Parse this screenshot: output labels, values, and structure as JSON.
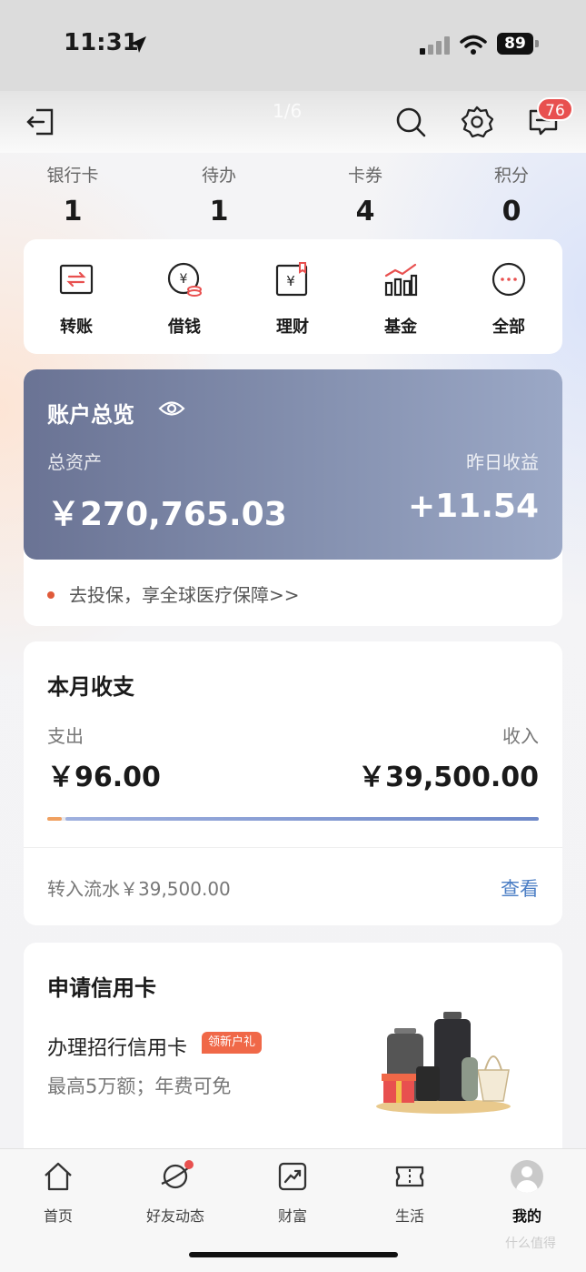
{
  "status_bar": {
    "time": "11:31",
    "battery": "89"
  },
  "topbar": {
    "page_indicator": "1/6",
    "message_badge": "76"
  },
  "stats": [
    {
      "label": "银行卡",
      "value": "1"
    },
    {
      "label": "待办",
      "value": "1"
    },
    {
      "label": "卡券",
      "value": "4"
    },
    {
      "label": "积分",
      "value": "0"
    }
  ],
  "quick_actions": [
    {
      "label": "转账",
      "icon": "transfer-icon"
    },
    {
      "label": "借钱",
      "icon": "borrow-icon"
    },
    {
      "label": "理财",
      "icon": "wealth-icon"
    },
    {
      "label": "基金",
      "icon": "fund-icon"
    },
    {
      "label": "全部",
      "icon": "more-icon"
    }
  ],
  "overview": {
    "title": "账户总览",
    "total_label": "总资产",
    "total_value": "￥270,765.03",
    "yield_label": "昨日收益",
    "yield_value": "+11.54",
    "promo": "去投保，享全球医疗保障>>"
  },
  "monthly": {
    "title": "本月收支",
    "expense_label": "支出",
    "expense_value": "￥96.00",
    "income_label": "收入",
    "income_value": "￥39,500.00",
    "expense_share": 0.03,
    "flow_text": "转入流水￥39,500.00",
    "view_link": "查看"
  },
  "credit": {
    "title": "申请信用卡",
    "name": "办理招行信用卡",
    "tag": "领新户礼",
    "subtitle": "最高5万额；年费可免"
  },
  "bottom_nav": [
    {
      "label": "首页",
      "icon": "home-icon"
    },
    {
      "label": "好友动态",
      "icon": "planet-icon"
    },
    {
      "label": "财富",
      "icon": "chart-icon"
    },
    {
      "label": "生活",
      "icon": "ticket-icon"
    },
    {
      "label": "我的",
      "icon": "avatar-icon",
      "active": true
    }
  ],
  "watermark": "什么值得",
  "colors": {
    "accent_red": "#e8504f",
    "overview_start": "#6a7394",
    "overview_end": "#9ba8c6",
    "link_blue": "#4a7dc4"
  }
}
